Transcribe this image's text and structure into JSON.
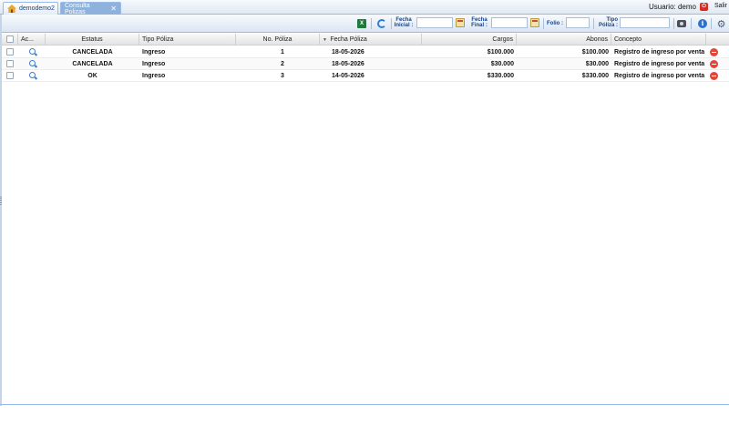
{
  "tabs": [
    {
      "label": "demodemo2",
      "active": false,
      "icon": "home-icon"
    },
    {
      "label": "Consulta Polizas",
      "active": true,
      "closable": true
    }
  ],
  "user": {
    "label": "Usuario: demo",
    "logout_label": "Salir"
  },
  "toolbar": {
    "fecha_inicial_label": "Fecha\nInicial :",
    "fecha_inicial_value": "",
    "fecha_final_label": "Fecha\nFinal :",
    "fecha_final_value": "",
    "folio_label": "Folio :",
    "folio_value": "",
    "tipo_poliza_label": "Tipo\nPóliza :",
    "tipo_poliza_value": "",
    "icons": [
      "excel-icon",
      "refresh-icon",
      "calendar-icon",
      "camera-icon",
      "info-icon",
      "settings-icon"
    ]
  },
  "grid": {
    "columns": [
      "Ac...",
      "Estatus",
      "Tipo Póliza",
      "No. Póliza",
      "Fecha Póliza",
      "Cargos",
      "Abonos",
      "Concepto"
    ],
    "sort_column": "Fecha Póliza",
    "rows": [
      {
        "estatus": "CANCELADA",
        "tipo": "Ingreso",
        "no": "1",
        "fecha": "18-05-2026",
        "cargos": "$100.000",
        "abonos": "$100.000",
        "concepto": "Registro de ingreso por venta d..."
      },
      {
        "estatus": "CANCELADA",
        "tipo": "Ingreso",
        "no": "2",
        "fecha": "18-05-2026",
        "cargos": "$30.000",
        "abonos": "$30.000",
        "concepto": "Registro de ingreso por venta d..."
      },
      {
        "estatus": "OK",
        "tipo": "Ingreso",
        "no": "3",
        "fecha": "14-05-2026",
        "cargos": "$330.000",
        "abonos": "$330.000",
        "concepto": "Registro de ingreso por venta d..."
      }
    ]
  },
  "colors": {
    "tab_active": "#8eb2dc",
    "border": "#99bbe8",
    "label": "#15428b",
    "delete": "#e2453a"
  }
}
